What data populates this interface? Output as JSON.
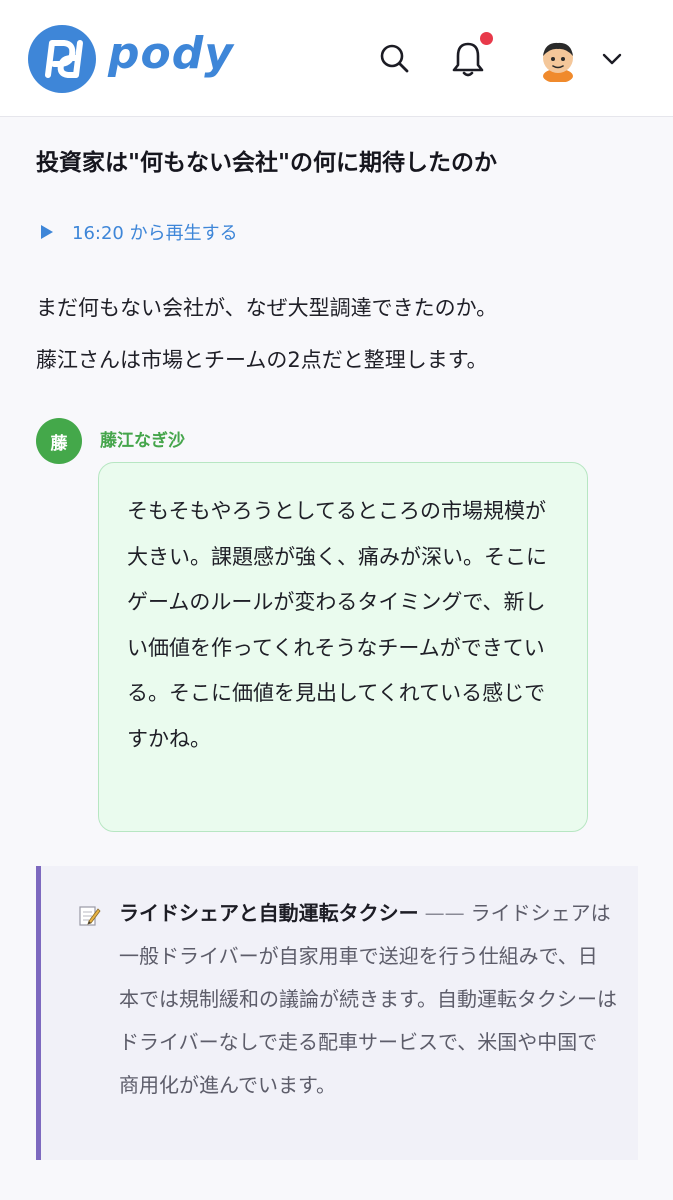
{
  "app": {
    "logo_text": "pody"
  },
  "header": {
    "icons": [
      "search-icon",
      "bell-icon",
      "user-avatar",
      "chevron-down-icon"
    ],
    "has_notification": true
  },
  "article": {
    "title": "投資家は\"何もない会社\"の何に期待したのか",
    "play_label": "16:20 から再生する",
    "intro_lines": [
      "まだ何もない会社が、なぜ大型調達できたのか。",
      "藤江さんは市場とチームの2点だと整理します。"
    ]
  },
  "speaker": {
    "initial": "藤",
    "name": "藤江なぎ沙",
    "quote": "そもそもやろうとしてるところの市場規模が大きい。課題感が強く、痛みが深い。そこにゲームのルールが変わるタイミングで、新しい価値を作ってくれそうなチームができている。そこに価値を見出してくれている感じですかね。"
  },
  "note": {
    "icon": "memo-icon",
    "title": "ライドシェアと自動運転タクシー",
    "dash": "——",
    "body": "ライドシェアは一般ドライバーが自家用車で送迎を行う仕組みで、日本では規制緩和の議論が続きます。自動運転タクシーはドライバーなしで走る配車サービスで、米国や中国で商用化が進んでいます。"
  },
  "colors": {
    "brand": "#3e86d8",
    "speaker_green": "#44a84a",
    "bubble_bg": "#eafbee",
    "note_accent": "#7d69bf",
    "notification": "#e8394a"
  }
}
